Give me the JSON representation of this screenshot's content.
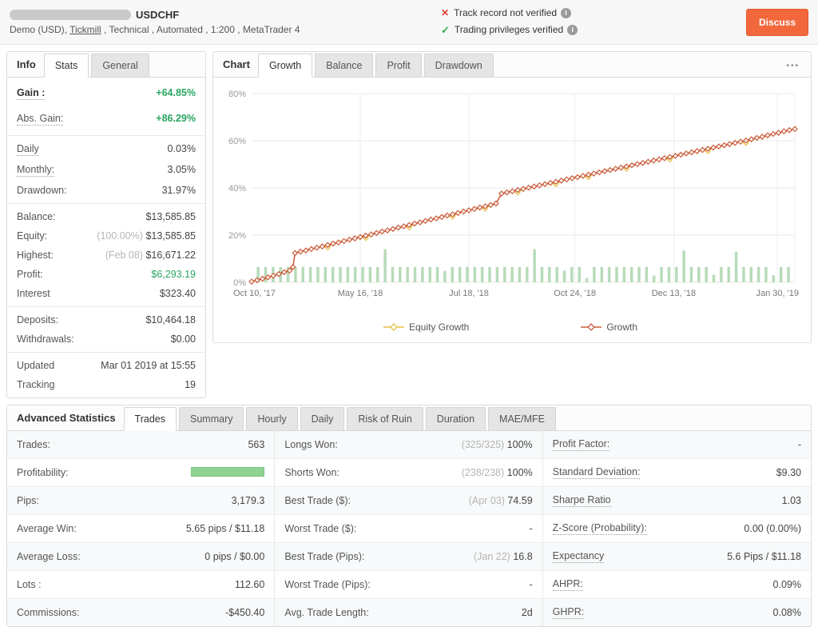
{
  "header": {
    "title_symbol": "USDCHF",
    "subtitle_prefix": "Demo (USD), ",
    "subtitle_link": "Tickmill",
    "subtitle_suffix": " , Technical , Automated , 1:200 , MetaTrader 4",
    "track_record_label": "Track record not verified",
    "privileges_label": "Trading privileges verified",
    "discuss_label": "Discuss"
  },
  "colors": {
    "gain_green": "#28a661",
    "discuss_orange": "#f2683c",
    "not_verified_red": "#e23d33",
    "verified_green": "#2faf4e",
    "growth_line": "#cb5c3c",
    "equity_line": "#e5c04c",
    "volume_bar_green": "#b7dbb9",
    "profitability_bar": "#8fd392"
  },
  "sidebar": {
    "label": "Info",
    "tabs": [
      {
        "label": "Stats",
        "active": true
      },
      {
        "label": "General",
        "active": false
      }
    ],
    "groups": [
      {
        "big": true,
        "rows": [
          {
            "label": "Gain :",
            "value": "+64.85%",
            "lc": "bold dotted",
            "vc": "green bold"
          },
          {
            "label": "Abs. Gain:",
            "value": "+86.29%",
            "lc": "dotted",
            "vc": "green bold"
          }
        ]
      },
      {
        "rows": [
          {
            "label": "Daily",
            "value": "0.03%",
            "lc": "dotted"
          },
          {
            "label": "Monthly:",
            "value": "3.05%",
            "lc": "dotted"
          },
          {
            "label": "Drawdown:",
            "value": "31.97%"
          }
        ]
      },
      {
        "rows": [
          {
            "label": "Balance:",
            "value": "$13,585.85"
          },
          {
            "label": "Equity:",
            "prefix": "(100.00%) ",
            "value": "$13,585.85"
          },
          {
            "label": "Highest:",
            "prefix": "(Feb 08) ",
            "value": "$16,671.22"
          },
          {
            "label": "Profit:",
            "value": "$6,293.19",
            "vc": "green"
          },
          {
            "label": "Interest",
            "value": "$323.40"
          }
        ]
      },
      {
        "rows": [
          {
            "label": "Deposits:",
            "value": "$10,464.18"
          },
          {
            "label": "Withdrawals:",
            "value": "$0.00"
          }
        ]
      },
      {
        "rows": [
          {
            "label": "Updated",
            "value": "Mar 01 2019 at 15:55"
          },
          {
            "label": "Tracking",
            "value": "19"
          }
        ]
      }
    ]
  },
  "chart_panel": {
    "label": "Chart",
    "tabs": [
      {
        "label": "Growth",
        "active": true
      },
      {
        "label": "Balance"
      },
      {
        "label": "Profit"
      },
      {
        "label": "Drawdown"
      }
    ],
    "menu_icon": "•••"
  },
  "chart_data": {
    "type": "line",
    "title": "Growth",
    "ylim": [
      0,
      80
    ],
    "yticks": [
      0,
      20,
      40,
      60,
      80
    ],
    "ytick_suffix": "%",
    "grid": true,
    "legend_position": "bottom",
    "x_ticks": [
      {
        "label": "Oct 10, '17",
        "x": 0.5,
        "grid": false
      },
      {
        "label": "May 16, '18",
        "x": 20,
        "grid": true
      },
      {
        "label": "Jul 18, '18",
        "x": 40,
        "grid": true
      },
      {
        "label": "Oct 24, '18",
        "x": 59.5,
        "grid": true
      },
      {
        "label": "Dec 13, '18",
        "x": 77.7,
        "grid": true
      },
      {
        "label": "Jan 30, '19",
        "x": 96.8,
        "grid": true
      }
    ],
    "series": [
      {
        "name": "Equity Growth",
        "color": "#e5c04c",
        "derived_from": "Growth",
        "dip_indices": [
          15,
          22,
          30,
          38,
          44,
          50,
          57,
          63,
          70,
          78,
          85,
          92
        ],
        "dip_delta": 1.1
      },
      {
        "name": "Growth",
        "color": "#cb5c3c",
        "points": [
          [
            0,
            0.3
          ],
          [
            1,
            0.9
          ],
          [
            2,
            1.5
          ],
          [
            3,
            2.1
          ],
          [
            4,
            2.8
          ],
          [
            5,
            3.5
          ],
          [
            6,
            4.3
          ],
          [
            7,
            5.0
          ],
          [
            7.6,
            6.5
          ],
          [
            8,
            12.4
          ],
          [
            9,
            13.0
          ],
          [
            10,
            13.5
          ],
          [
            11,
            14.1
          ],
          [
            12,
            14.7
          ],
          [
            13,
            15.2
          ],
          [
            14,
            15.8
          ],
          [
            15,
            16.4
          ],
          [
            16,
            16.9
          ],
          [
            17,
            17.5
          ],
          [
            18,
            18.1
          ],
          [
            19,
            18.6
          ],
          [
            20,
            19.2
          ],
          [
            21,
            19.8
          ],
          [
            22,
            20.3
          ],
          [
            23,
            20.9
          ],
          [
            24,
            21.5
          ],
          [
            25,
            22.0
          ],
          [
            26,
            22.6
          ],
          [
            27,
            23.2
          ],
          [
            28,
            23.7
          ],
          [
            29,
            24.3
          ],
          [
            30,
            24.9
          ],
          [
            31,
            25.4
          ],
          [
            32,
            26.0
          ],
          [
            33,
            26.6
          ],
          [
            34,
            27.1
          ],
          [
            35,
            27.7
          ],
          [
            36,
            28.3
          ],
          [
            37,
            28.8
          ],
          [
            38,
            29.4
          ],
          [
            39,
            30.0
          ],
          [
            40,
            30.5
          ],
          [
            41,
            31.1
          ],
          [
            42,
            31.7
          ],
          [
            43,
            32.2
          ],
          [
            44,
            32.8
          ],
          [
            45,
            33.4
          ],
          [
            46,
            37.6
          ],
          [
            47,
            38.1
          ],
          [
            48,
            38.6
          ],
          [
            49,
            39.1
          ],
          [
            50,
            39.6
          ],
          [
            51,
            40.1
          ],
          [
            52,
            40.6
          ],
          [
            53,
            41.1
          ],
          [
            54,
            41.6
          ],
          [
            55,
            42.1
          ],
          [
            56,
            42.6
          ],
          [
            57,
            43.1
          ],
          [
            58,
            43.6
          ],
          [
            59,
            44.1
          ],
          [
            60,
            44.6
          ],
          [
            61,
            45.1
          ],
          [
            62,
            45.6
          ],
          [
            63,
            46.1
          ],
          [
            64,
            46.6
          ],
          [
            65,
            47.1
          ],
          [
            66,
            47.6
          ],
          [
            67,
            48.1
          ],
          [
            68,
            48.6
          ],
          [
            69,
            49.1
          ],
          [
            70,
            49.6
          ],
          [
            71,
            50.1
          ],
          [
            72,
            50.6
          ],
          [
            73,
            51.1
          ],
          [
            74,
            51.6
          ],
          [
            75,
            52.1
          ],
          [
            76,
            52.6
          ],
          [
            77,
            53.1
          ],
          [
            78,
            53.6
          ],
          [
            79,
            54.1
          ],
          [
            80,
            54.6
          ],
          [
            81,
            55.1
          ],
          [
            82,
            55.6
          ],
          [
            83,
            56.1
          ],
          [
            84,
            56.6
          ],
          [
            85,
            57.1
          ],
          [
            86,
            57.6
          ],
          [
            87,
            58.1
          ],
          [
            88,
            58.6
          ],
          [
            89,
            59.1
          ],
          [
            90,
            59.6
          ],
          [
            91,
            60.1
          ],
          [
            92,
            60.6
          ],
          [
            93,
            61.2
          ],
          [
            94,
            61.7
          ],
          [
            95,
            62.3
          ],
          [
            96,
            62.9
          ],
          [
            97,
            63.4
          ],
          [
            98,
            64.0
          ],
          [
            99,
            64.5
          ],
          [
            100,
            65.0
          ]
        ]
      }
    ],
    "volume_bars": {
      "color": "#b7dbb9",
      "start": 1.2,
      "step": 1.375,
      "heights": [
        6.5,
        6.5,
        6.5,
        6.5,
        6.5,
        6.5,
        6.5,
        6.5,
        6.5,
        6.5,
        6.5,
        6.5,
        6.5,
        6.5,
        6.5,
        6.5,
        6.5,
        14,
        6.5,
        6.5,
        6.5,
        6.5,
        6.5,
        6.5,
        6.5,
        4.8,
        6.5,
        6.5,
        6.5,
        6.5,
        6.5,
        6.5,
        6.5,
        6.5,
        6.5,
        6.5,
        6.5,
        14,
        6.5,
        6.5,
        6.5,
        5,
        6.5,
        6.5,
        1.8,
        6.5,
        6.5,
        6.5,
        6.5,
        6.5,
        6.5,
        6.5,
        6.5,
        2.8,
        6.5,
        6.5,
        6.5,
        13.5,
        6.5,
        6.5,
        6.5,
        3.2,
        6.5,
        6.5,
        13,
        6.5,
        6.5,
        6.5,
        6.5,
        3,
        6.5,
        6.5
      ]
    }
  },
  "stats_panel": {
    "label": "Advanced Statistics",
    "tabs": [
      {
        "label": "Trades",
        "active": true
      },
      {
        "label": "Summary"
      },
      {
        "label": "Hourly"
      },
      {
        "label": "Daily"
      },
      {
        "label": "Risk of Ruin"
      },
      {
        "label": "Duration"
      },
      {
        "label": "MAE/MFE"
      }
    ],
    "columns": [
      [
        {
          "label": "Trades:",
          "value": "563"
        },
        {
          "label": "Profitability:",
          "bar": true
        },
        {
          "label": "Pips:",
          "value": "3,179.3"
        },
        {
          "label": "Average Win:",
          "value": "5.65 pips / $11.18"
        },
        {
          "label": "Average Loss:",
          "value": "0 pips / $0.00"
        },
        {
          "label": "Lots :",
          "value": "112.60"
        },
        {
          "label": "Commissions:",
          "value": "-$450.40"
        }
      ],
      [
        {
          "label": "Longs Won:",
          "prefix": "(325/325) ",
          "value": "100%"
        },
        {
          "label": "Shorts Won:",
          "prefix": "(238/238) ",
          "value": "100%"
        },
        {
          "label": "Best Trade ($):",
          "prefix": "(Apr 03) ",
          "value": "74.59"
        },
        {
          "label": "Worst Trade ($):",
          "value": "-"
        },
        {
          "label": "Best Trade (Pips):",
          "prefix": "(Jan 22) ",
          "value": "16.8"
        },
        {
          "label": "Worst Trade (Pips):",
          "value": "-"
        },
        {
          "label": "Avg. Trade Length:",
          "value": "2d"
        }
      ],
      [
        {
          "label": "Profit Factor:",
          "value": "-",
          "dotted": true
        },
        {
          "label": "Standard Deviation:",
          "value": "$9.30",
          "dotted": true
        },
        {
          "label": "Sharpe Ratio",
          "value": "1.03",
          "dotted": true
        },
        {
          "label": "Z-Score (Probability):",
          "value": "0.00 (0.00%)",
          "dotted": true
        },
        {
          "label": "Expectancy",
          "value": "5.6 Pips / $11.18",
          "dotted": true
        },
        {
          "label": "AHPR:",
          "value": "0.09%",
          "dotted": true
        },
        {
          "label": "GHPR:",
          "value": "0.08%",
          "dotted": true
        }
      ]
    ]
  }
}
